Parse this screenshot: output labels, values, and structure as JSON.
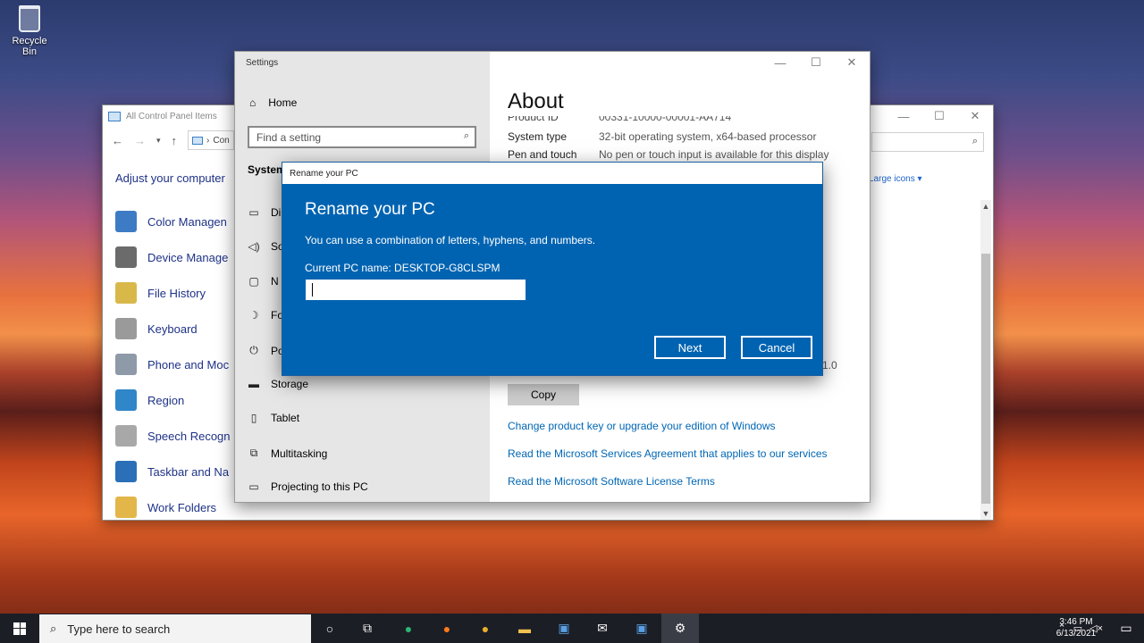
{
  "desktop": {
    "recycle_bin_label": "Recycle Bin"
  },
  "control_panel": {
    "title": "All Control Panel Items",
    "address": "Con",
    "heading": "Adjust your computer",
    "view_by": "Large icons",
    "items": [
      {
        "label": "Color Managen",
        "icon": "color-management-icon",
        "color": "#3d7bc4"
      },
      {
        "label": "Device Manage",
        "icon": "device-manager-icon",
        "color": "#6b6b6b"
      },
      {
        "label": "File History",
        "icon": "file-history-icon",
        "color": "#d9b84a"
      },
      {
        "label": "Keyboard",
        "icon": "keyboard-icon",
        "color": "#9a9a9a"
      },
      {
        "label": "Phone and Moc",
        "icon": "phone-modem-icon",
        "color": "#8e9aa8"
      },
      {
        "label": "Region",
        "icon": "region-globe-icon",
        "color": "#2f86c9"
      },
      {
        "label": "Speech Recogn",
        "icon": "microphone-icon",
        "color": "#a8a8a8"
      },
      {
        "label": "Taskbar and Na",
        "icon": "taskbar-icon",
        "color": "#2a6fb8"
      },
      {
        "label": "Work Folders",
        "icon": "work-folders-icon",
        "color": "#e3b64a"
      }
    ]
  },
  "settings": {
    "title": "Settings",
    "home": "Home",
    "search_placeholder": "Find a setting",
    "section": "System",
    "nav": [
      {
        "label": "Di",
        "icon": "display-icon",
        "glyph": "▭"
      },
      {
        "label": "So",
        "icon": "sound-icon",
        "glyph": "◁)"
      },
      {
        "label": "N",
        "icon": "notifications-icon",
        "glyph": "▢"
      },
      {
        "label": "Fo",
        "icon": "focus-assist-icon",
        "glyph": "☽"
      },
      {
        "label": "Po",
        "icon": "power-icon",
        "glyph": "⏻"
      },
      {
        "label": "Storage",
        "icon": "storage-icon",
        "glyph": "▬"
      },
      {
        "label": "Tablet",
        "icon": "tablet-icon",
        "glyph": "▯"
      },
      {
        "label": "Multitasking",
        "icon": "multitasking-icon",
        "glyph": "⧉"
      },
      {
        "label": "Projecting to this PC",
        "icon": "projecting-icon",
        "glyph": "▭"
      }
    ],
    "about_title": "About",
    "product_id_label": "Product ID",
    "product_id_value": "00331-10000-00001-AA714",
    "system_type_label": "System type",
    "system_type_value": "32-bit operating system, x64-based processor",
    "pen_label": "Pen and touch",
    "pen_value": "No pen or touch input is available for this display",
    "partial_value": "1.0",
    "copy_button": "Copy",
    "links": [
      "Change product key or upgrade your edition of Windows",
      "Read the Microsoft Services Agreement that applies to our services",
      "Read the Microsoft Software License Terms"
    ]
  },
  "dialog": {
    "title": "Rename your PC",
    "heading": "Rename your PC",
    "description": "You can use a combination of letters, hyphens, and numbers.",
    "current_name": "Current PC name: DESKTOP-G8CLSPM",
    "input_value": "",
    "next_button": "Next",
    "cancel_button": "Cancel"
  },
  "taskbar": {
    "search_placeholder": "Type here to search",
    "time": "3:46 PM",
    "date": "6/13/2021",
    "apps": [
      {
        "name": "cortana-icon",
        "color": "#ffffff"
      },
      {
        "name": "task-view-icon",
        "color": "#ffffff"
      },
      {
        "name": "edge-icon",
        "color": "#2bb673"
      },
      {
        "name": "firefox-icon",
        "color": "#ff7a1a"
      },
      {
        "name": "chrome-icon",
        "color": "#e6b12a"
      },
      {
        "name": "file-explorer-icon",
        "color": "#f2c14e"
      },
      {
        "name": "store-icon",
        "color": "#5aa0e6"
      },
      {
        "name": "mail-icon",
        "color": "#ffffff"
      },
      {
        "name": "control-panel-icon",
        "color": "#5aa0e6"
      },
      {
        "name": "settings-icon",
        "color": "#ffffff"
      }
    ]
  }
}
